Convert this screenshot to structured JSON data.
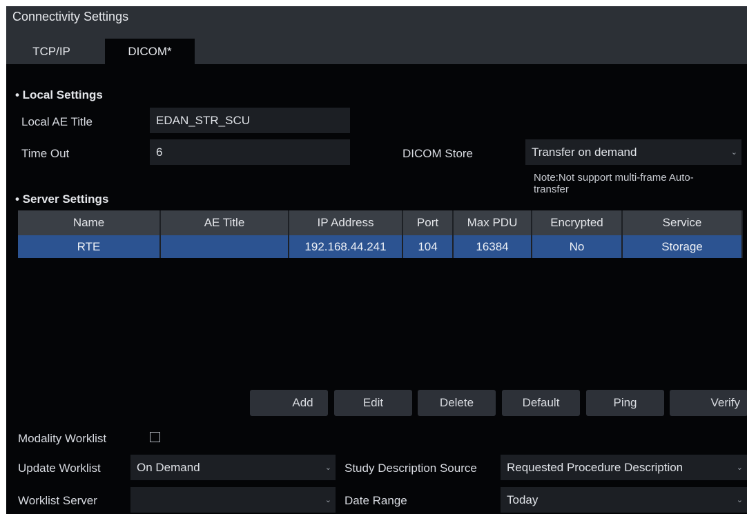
{
  "window": {
    "title": "Connectivity Settings"
  },
  "tabs": [
    {
      "label": "TCP/IP",
      "active": false
    },
    {
      "label": "DICOM*",
      "active": true
    }
  ],
  "local_settings": {
    "heading": "• Local Settings",
    "ae_title_label": "Local AE Title",
    "ae_title_value": "EDAN_STR_SCU",
    "timeout_label": "Time Out",
    "timeout_value": "6",
    "dicom_store_label": "DICOM Store",
    "dicom_store_value": "Transfer on demand",
    "note_line1": "Note:Not support multi-frame Auto-",
    "note_line2": "transfer"
  },
  "server_settings": {
    "heading": "• Server Settings",
    "columns": [
      "Name",
      "AE Title",
      "IP Address",
      "Port",
      "Max PDU",
      "Encrypted",
      "Service"
    ],
    "rows": [
      [
        "RTE",
        "",
        "192.168.44.241",
        "104",
        "16384",
        "No",
        "Storage"
      ]
    ]
  },
  "buttons": {
    "add": "Add",
    "edit": "Edit",
    "delete": "Delete",
    "default": "Default",
    "ping": "Ping",
    "verify": "Verify"
  },
  "worklist": {
    "modality_label": "Modality Worklist",
    "modality_checked": false,
    "update_label": "Update Worklist",
    "update_value": "On Demand",
    "server_label": "Worklist Server",
    "server_value": "",
    "study_desc_label": "Study Description Source",
    "study_desc_value": "Requested Procedure Description",
    "date_range_label": "Date Range",
    "date_range_value": "Today"
  },
  "colors": {
    "background": "#040507",
    "header_bar": "#2c3036",
    "selected_row": "#2c5391",
    "field_bg": "#1c1f24"
  },
  "icons": {
    "dropdown": "chevron-down-icon",
    "checkbox": "checkbox-icon"
  }
}
